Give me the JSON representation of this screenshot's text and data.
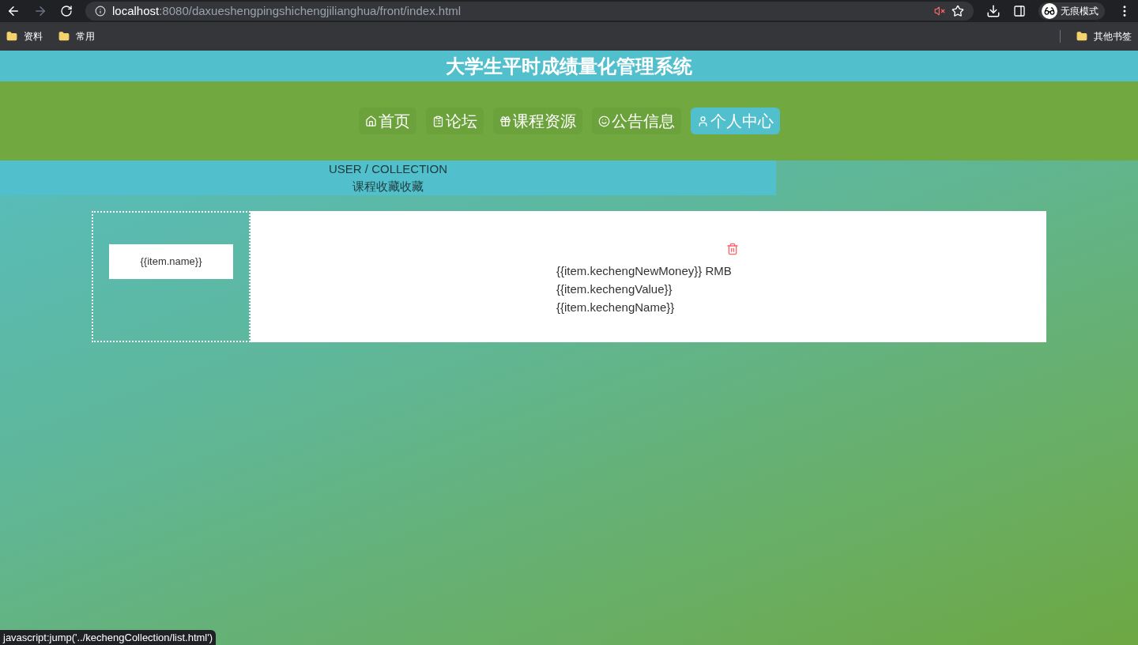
{
  "browser": {
    "url_host": "localhost",
    "url_path": ":8080/daxueshengpingshichengjilianghua/front/index.html",
    "profile_label": "无痕模式",
    "bookmarks": [
      "资料",
      "常用"
    ],
    "other_bookmarks": "其他书签"
  },
  "site_title": "大学生平时成绩量化管理系统",
  "nav": [
    {
      "label": "首页",
      "kind": "home",
      "selected": false
    },
    {
      "label": "论坛",
      "kind": "forum",
      "selected": false
    },
    {
      "label": "课程资源",
      "kind": "course",
      "selected": false
    },
    {
      "label": "公告信息",
      "kind": "notice",
      "selected": false
    },
    {
      "label": "个人中心",
      "kind": "user",
      "selected": true
    }
  ],
  "breadcrumb": {
    "path": "USER / COLLECTION",
    "title": "课程收藏收藏"
  },
  "item": {
    "name": "{{item.name}}",
    "lines": [
      "{{item.kechengNewMoney}} RMB",
      "{{item.kechengValue}}",
      "{{item.kechengName}}"
    ]
  },
  "status_url": "javascript:jump('../kechengCollection/list.html')"
}
